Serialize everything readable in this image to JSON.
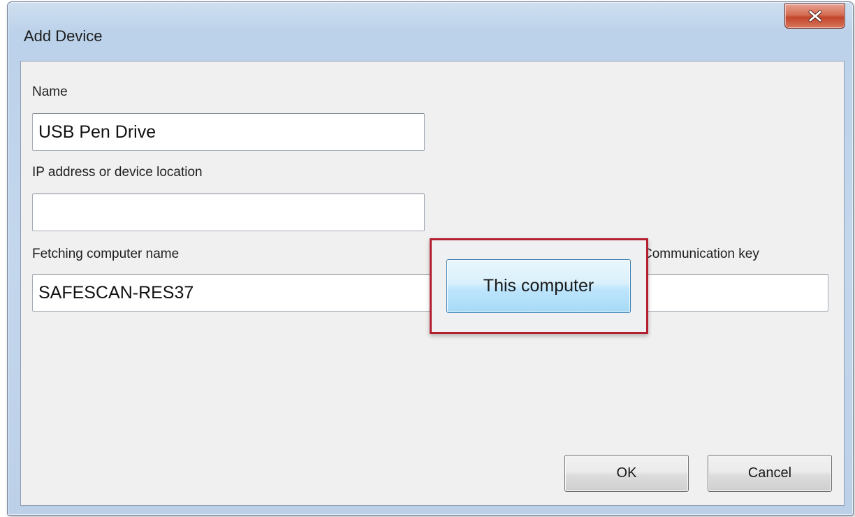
{
  "window": {
    "title": "Add Device"
  },
  "icons": {
    "close": "close-icon"
  },
  "form": {
    "name": {
      "label": "Name",
      "value": "USB Pen Drive"
    },
    "ip_address": {
      "label": "IP address or device location",
      "value": ""
    },
    "computer_name": {
      "label": "Fetching computer name",
      "value": "SAFESCAN-RES37"
    },
    "communication_key": {
      "label": "Communication key",
      "value": ""
    },
    "this_computer_button": "This computer"
  },
  "buttons": {
    "ok": "OK",
    "cancel": "Cancel"
  },
  "colors": {
    "highlight_border": "#b4202f",
    "close_button": "#c2452b",
    "this_computer_button": "#bee6fd"
  }
}
